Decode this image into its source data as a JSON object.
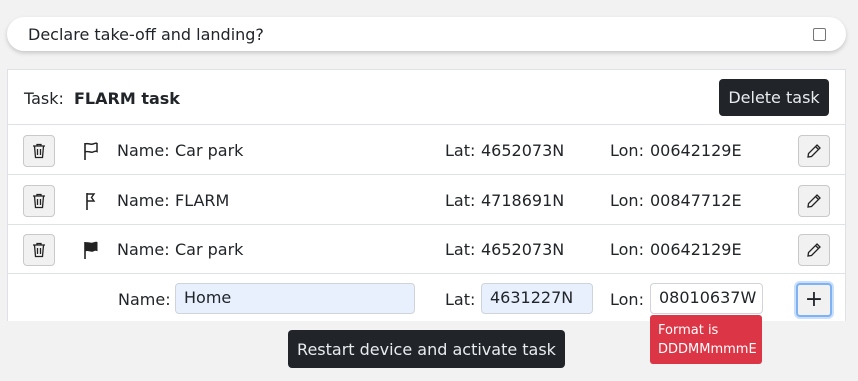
{
  "declare": {
    "label": "Declare take-off and landing?",
    "checked": false
  },
  "task": {
    "label": "Task:",
    "name": "FLARM task",
    "delete_label": "Delete task"
  },
  "labels": {
    "name": "Name:",
    "lat": "Lat:",
    "lon": "Lon:"
  },
  "waypoints": [
    {
      "name": "Car park",
      "lat": "4652073N",
      "lon": "00642129E",
      "icon": "start-flag-icon"
    },
    {
      "name": "FLARM",
      "lat": "4718691N",
      "lon": "00847712E",
      "icon": "turnpoint-flag-icon"
    },
    {
      "name": "Car park",
      "lat": "4652073N",
      "lon": "00642129E",
      "icon": "finish-flag-icon"
    }
  ],
  "new_waypoint": {
    "name": "Home",
    "lat": "4631227N",
    "lon": "08010637W",
    "add_label": "+"
  },
  "validation": {
    "lon_error": "Format is DDDMMmmmE"
  },
  "restart_label": "Restart device and activate task",
  "colors": {
    "error": "#dc3545",
    "dark_button": "#212529",
    "autofill": "#e8f0fe"
  }
}
